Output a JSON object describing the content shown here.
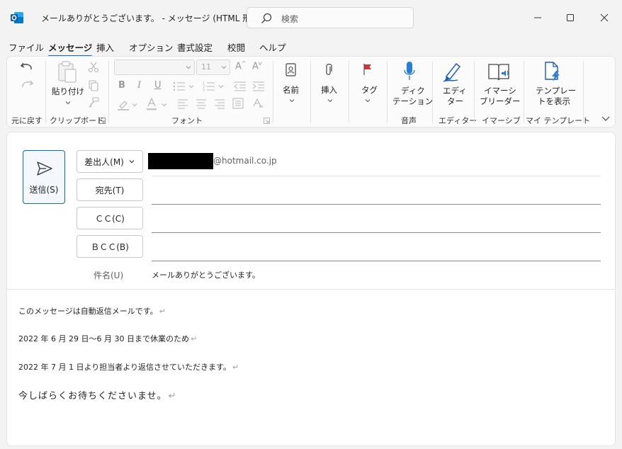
{
  "titlebar": {
    "title": "メールありがとうございます。 - メッセージ (HTML 形式)",
    "search_placeholder": "検索"
  },
  "menu": {
    "tabs": [
      "ファイル",
      "メッセージ",
      "挿入",
      "オプション",
      "書式設定",
      "校閲",
      "ヘルプ"
    ],
    "active": "メッセージ"
  },
  "ribbon": {
    "undo_group": "元に戻す",
    "clipboard_group": "クリップボード",
    "paste_label": "貼り付け",
    "font_group": "フォント",
    "font_name": "",
    "font_size": "11",
    "names_label": "名前",
    "insert_label": "挿入",
    "tag_label": "タグ",
    "dictation_label_1": "ディク",
    "dictation_label_2": "テーション",
    "voice_group": "音声",
    "editor_label_1": "エディ",
    "editor_label_2": "ター",
    "editor_group": "エディター",
    "immersive_label_1": "イマーシ",
    "immersive_label_2": "ブリーダー",
    "immersive_group": "イマーシブ",
    "template_label_1": "テンプレー",
    "template_label_2": "トを表示",
    "template_group": "マイ テンプレート"
  },
  "compose": {
    "send_label": "送信(S)",
    "from_label": "差出人(M)",
    "from_domain": "@hotmail.co.jp",
    "to_label": "宛先(T)",
    "cc_label": "ＣＣ(C)",
    "bcc_label": "ＢＣＣ(B)",
    "subject_label": "件名(U)",
    "subject_value": "メールありがとうございます。"
  },
  "body": {
    "line1": "このメッセージは自動返信メールです。",
    "line2": "2022 年 6 月 29 日〜6 月 30 日まで休業のため",
    "line3": "2022 年 7 月 1 日より担当者より返信させていただきます。",
    "line4": "今しばらくお待ちくださいませ。",
    "paragraph_mark": "↵"
  },
  "colors": {
    "accent": "#0f6cbd",
    "outlook_blue": "#0078d4",
    "flag_red": "#d13438"
  }
}
